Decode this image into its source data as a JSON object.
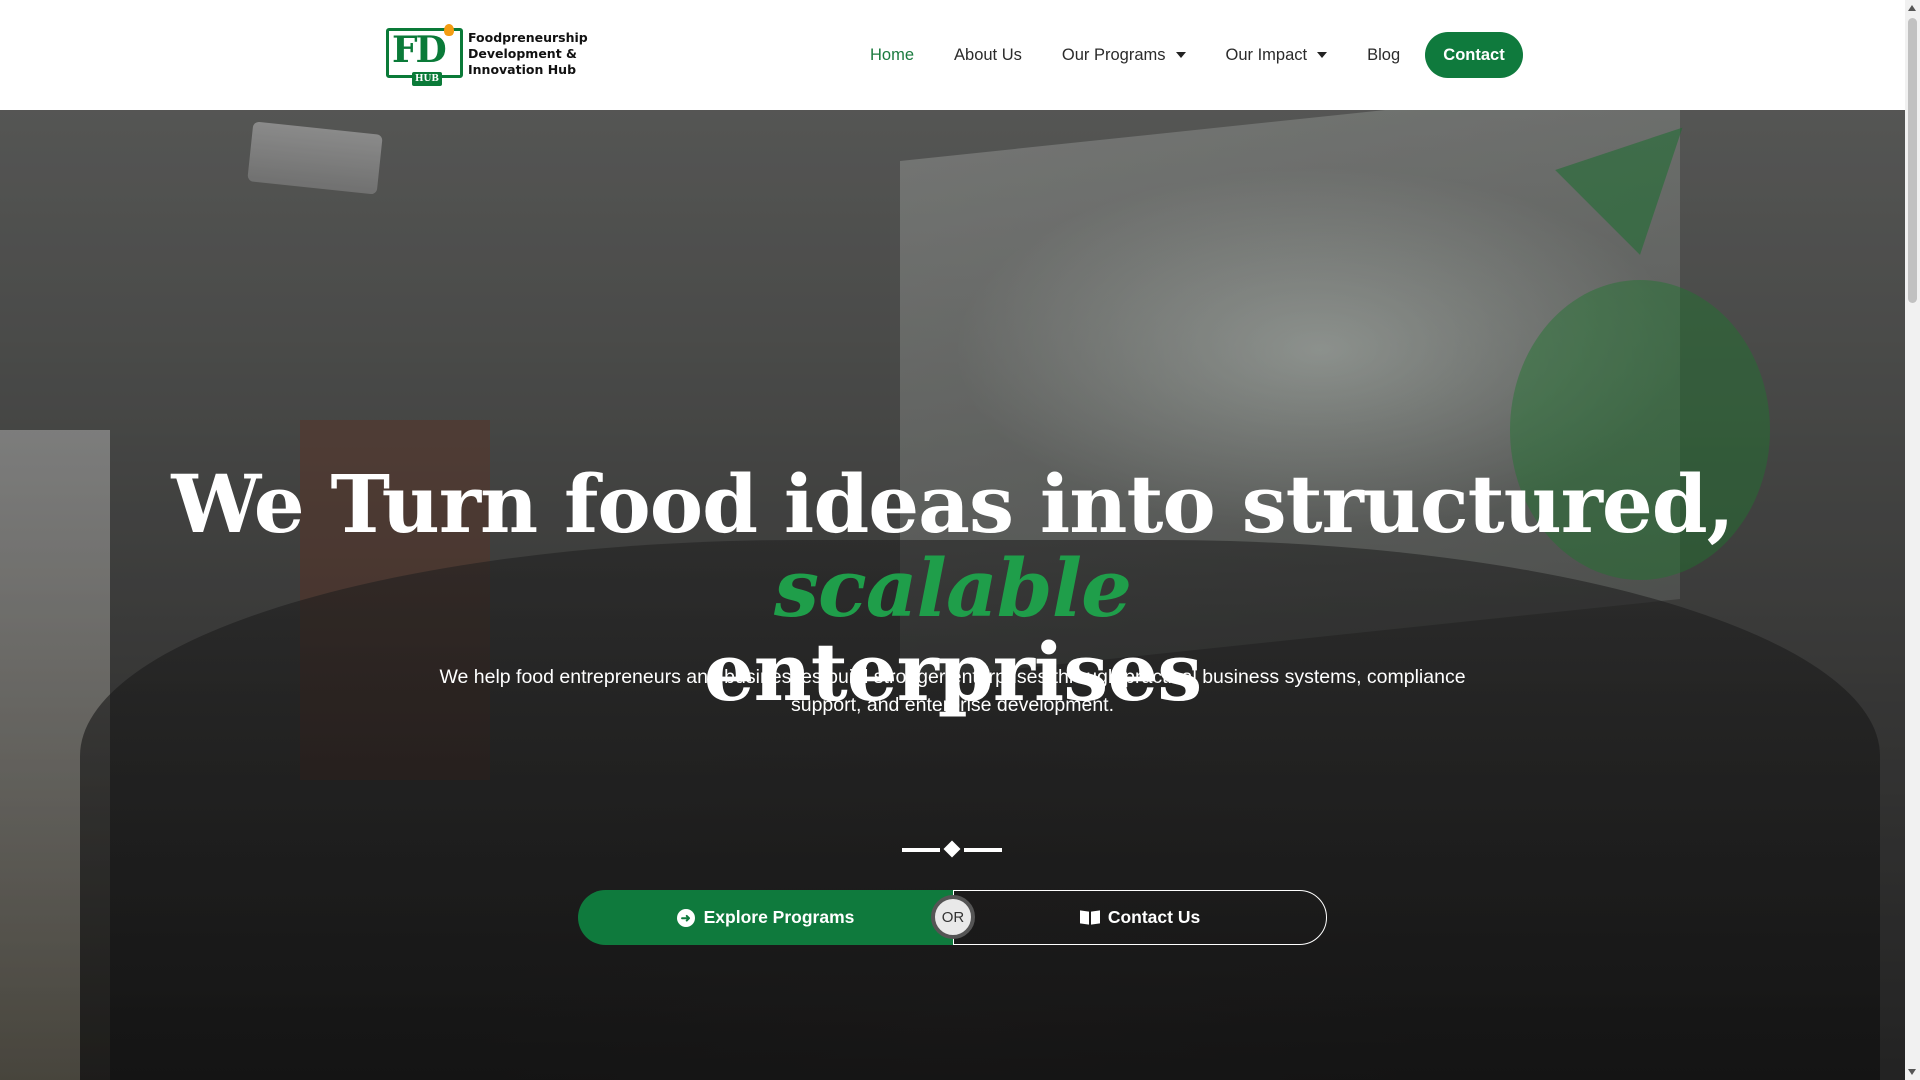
{
  "brand": {
    "logo_mark": "FD",
    "logo_badge": "HUB",
    "name_lines": [
      "Foodpreneurship",
      "Development &",
      "Innovation Hub"
    ],
    "color": "#0f7a3d"
  },
  "nav": {
    "items": [
      {
        "label": "Home",
        "active": true,
        "dropdown": false
      },
      {
        "label": "About Us",
        "active": false,
        "dropdown": false
      },
      {
        "label": "Our Programs",
        "active": false,
        "dropdown": true
      },
      {
        "label": "Our Impact",
        "active": false,
        "dropdown": true
      },
      {
        "label": "Blog",
        "active": false,
        "dropdown": false
      }
    ],
    "cta_label": "Contact"
  },
  "hero": {
    "headline_main": "We Turn food ideas into structured,",
    "headline_accent": "scalable",
    "headline_end": "enterprises",
    "subtext": "We help food entrepreneurs and businesses build stronger enterprises through practical business systems, compliance support, and enterprise development.",
    "primary_button": {
      "label": "Explore Programs",
      "icon": "arrow-circle-right-icon"
    },
    "separator_label": "OR",
    "secondary_button": {
      "label": "Contact Us",
      "icon": "book-open-icon"
    },
    "accent_color": "#1f9e4a"
  }
}
